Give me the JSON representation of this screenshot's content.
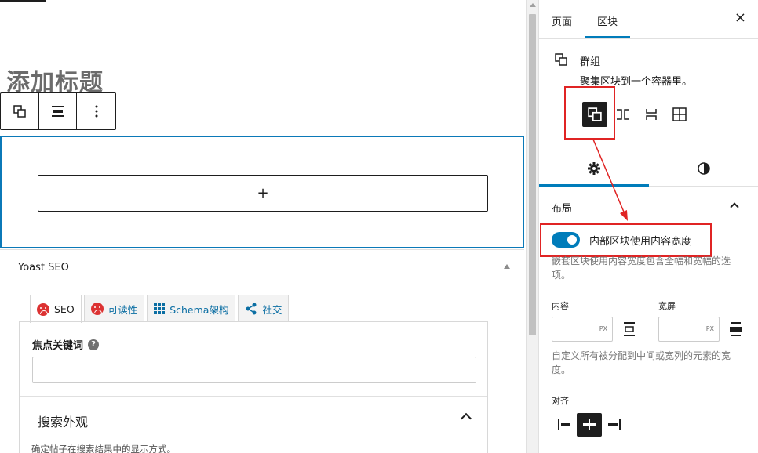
{
  "editor": {
    "post_title_placeholder": "添加标题",
    "appender_label": "+"
  },
  "yoast": {
    "title": "Yoast SEO",
    "tabs": [
      {
        "label": "SEO",
        "icon": "sad-face-icon",
        "active": true
      },
      {
        "label": "可读性",
        "icon": "sad-face-icon",
        "active": false
      },
      {
        "label": "Schema架构",
        "icon": "grid-icon",
        "active": false
      },
      {
        "label": "社交",
        "icon": "share-icon",
        "active": false
      }
    ],
    "focus_keyword_label": "焦点关键词",
    "help_glyph": "?",
    "search_appearance_title": "搜索外观",
    "search_appearance_desc": "确定帖子在搜索结果中的显示方式。"
  },
  "sidebar": {
    "tab_page": "页面",
    "tab_block": "区块",
    "close": "×",
    "block_name": "群组",
    "block_desc": "聚集区块到一个容器里。",
    "layout_heading": "布局",
    "toggle_label": "内部区块使用内容宽度",
    "toggle_on": true,
    "toggle_help": "嵌套区块使用内容宽度包含全幅和宽幅的选项。",
    "content_label": "内容",
    "wide_label": "宽屏",
    "unit": "PX",
    "width_help": "自定义所有被分配到中间或宽列的元素的宽度。",
    "align_label": "对齐"
  },
  "colors": {
    "accent": "#007cba",
    "highlight": "#e02424",
    "yoast_bad": "#dc3232"
  }
}
